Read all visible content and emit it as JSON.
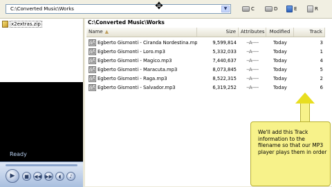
{
  "toolbar": {
    "path": "C:\\Converted Music\\Works",
    "drives": [
      {
        "label": "C",
        "icon": "hard-drive-icon"
      },
      {
        "label": "D",
        "icon": "hard-drive-icon"
      },
      {
        "label": "E",
        "icon": "removable-drive-icon"
      },
      {
        "label": "R",
        "icon": "network-drive-icon"
      }
    ]
  },
  "left": {
    "zip_file": "x2extras.zip"
  },
  "player": {
    "status": "Ready"
  },
  "list": {
    "folder_title": "C:\\Converted Music\\Works",
    "columns": {
      "name": "Name",
      "size": "Size",
      "attributes": "Attributes",
      "modified": "Modified",
      "track": "Track"
    },
    "rows": [
      {
        "name": "Egberto Gismonti - Ciranda Nordestina.mp3",
        "size": "9,599,814",
        "attr": "--A-----",
        "modified": "Today",
        "track": "3"
      },
      {
        "name": "Egberto Gismonti - Loro.mp3",
        "size": "5,332,033",
        "attr": "--A-----",
        "modified": "Today",
        "track": "1"
      },
      {
        "name": "Egberto Gismonti - Magico.mp3",
        "size": "7,440,637",
        "attr": "--A-----",
        "modified": "Today",
        "track": "4"
      },
      {
        "name": "Egberto Gismonti - Maracuta.mp3",
        "size": "8,073,845",
        "attr": "--A-----",
        "modified": "Today",
        "track": "5"
      },
      {
        "name": "Egberto Gismonti - Raga.mp3",
        "size": "8,522,315",
        "attr": "--A-----",
        "modified": "Today",
        "track": "2"
      },
      {
        "name": "Egberto Gismonti - Salvador.mp3",
        "size": "6,319,252",
        "attr": "--A-----",
        "modified": "Today",
        "track": "6"
      }
    ]
  },
  "callout": {
    "text": "We'll add this Track information to the filename so that our MP3 player plays them in order"
  },
  "colors": {
    "callout_bg": "#f7f28a",
    "video_bg": "#000000"
  }
}
